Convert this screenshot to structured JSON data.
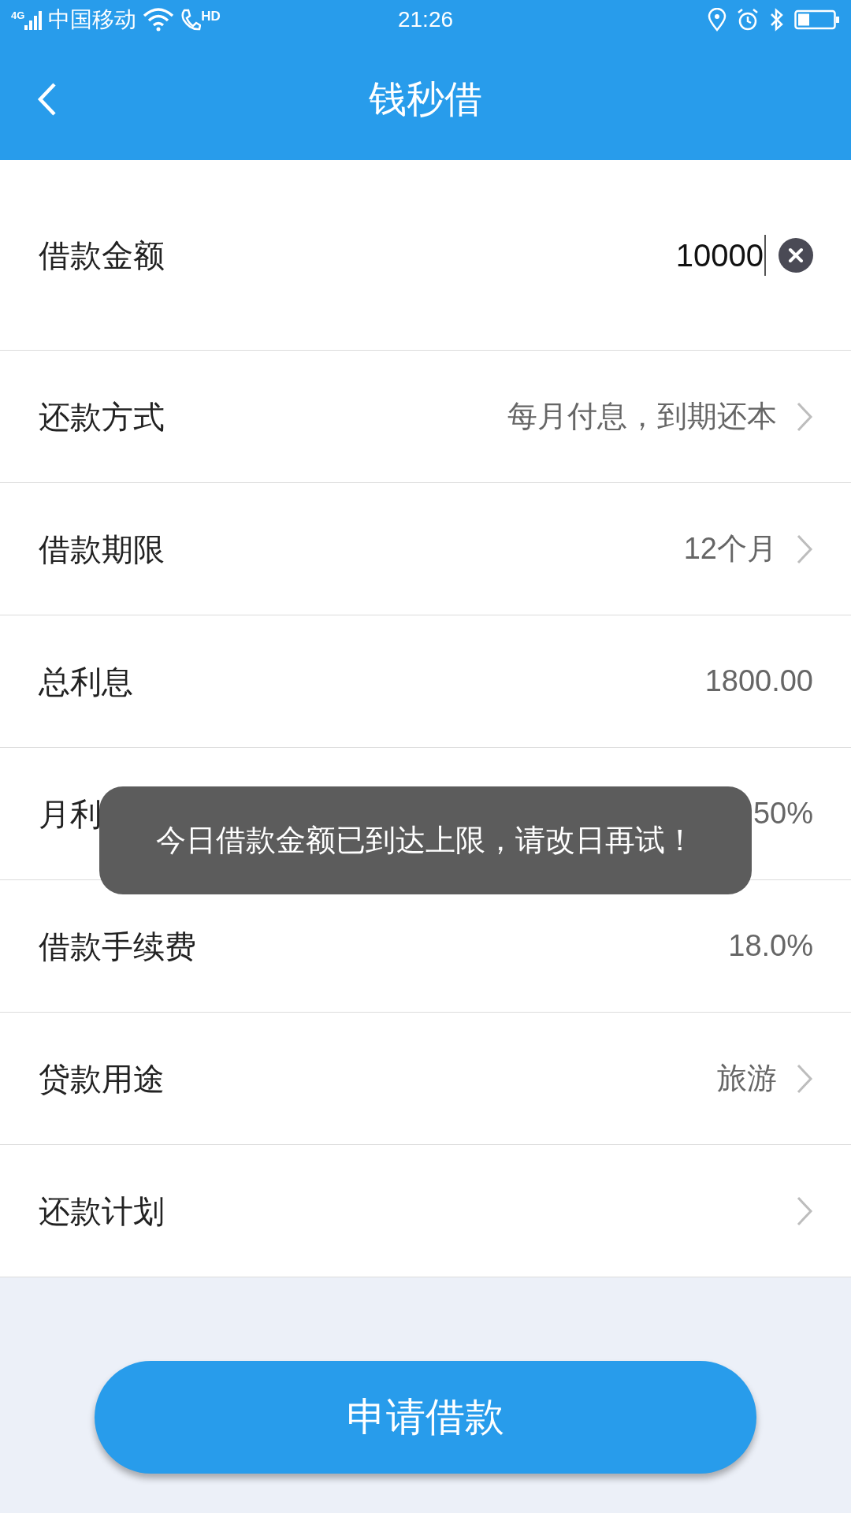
{
  "status_bar": {
    "network": "4G",
    "carrier": "中国移动",
    "call": "HD",
    "time": "21:26"
  },
  "header": {
    "title": "钱秒借"
  },
  "rows": [
    {
      "kind": "input",
      "label": "借款金额",
      "value": "10000"
    },
    {
      "kind": "select",
      "label": "还款方式",
      "value": "每月付息，到期还本"
    },
    {
      "kind": "select",
      "label": "借款期限",
      "value": "12个月"
    },
    {
      "kind": "text",
      "label": "总利息",
      "value": "1800.00"
    },
    {
      "kind": "text",
      "label": "月利",
      "value": "50%"
    },
    {
      "kind": "text",
      "label": "借款手续费",
      "value": "18.0%"
    },
    {
      "kind": "select",
      "label": "贷款用途",
      "value": "旅游"
    },
    {
      "kind": "select",
      "label": "还款计划"
    }
  ],
  "submit_button": "申请借款",
  "toast": "今日借款金额已到达上限，请改日再试！"
}
